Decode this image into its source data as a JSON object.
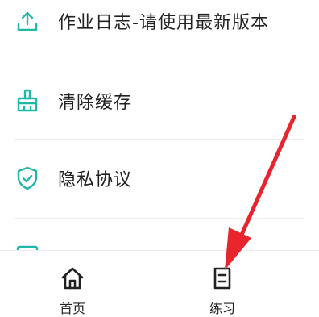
{
  "menu": {
    "items": [
      {
        "label": "作业日志-请使用最新版本",
        "icon": "upload-icon"
      },
      {
        "label": "清除缓存",
        "icon": "broom-icon"
      },
      {
        "label": "隐私协议",
        "icon": "shield-icon"
      },
      {
        "label": "",
        "icon": "calendar-icon"
      }
    ]
  },
  "tabbar": {
    "tabs": [
      {
        "label": "首页",
        "icon": "home-icon"
      },
      {
        "label": "练习",
        "icon": "document-icon"
      }
    ]
  },
  "colors": {
    "accent": "#1fb8a6",
    "text": "#222222",
    "annotation_arrow": "#e8242c"
  }
}
